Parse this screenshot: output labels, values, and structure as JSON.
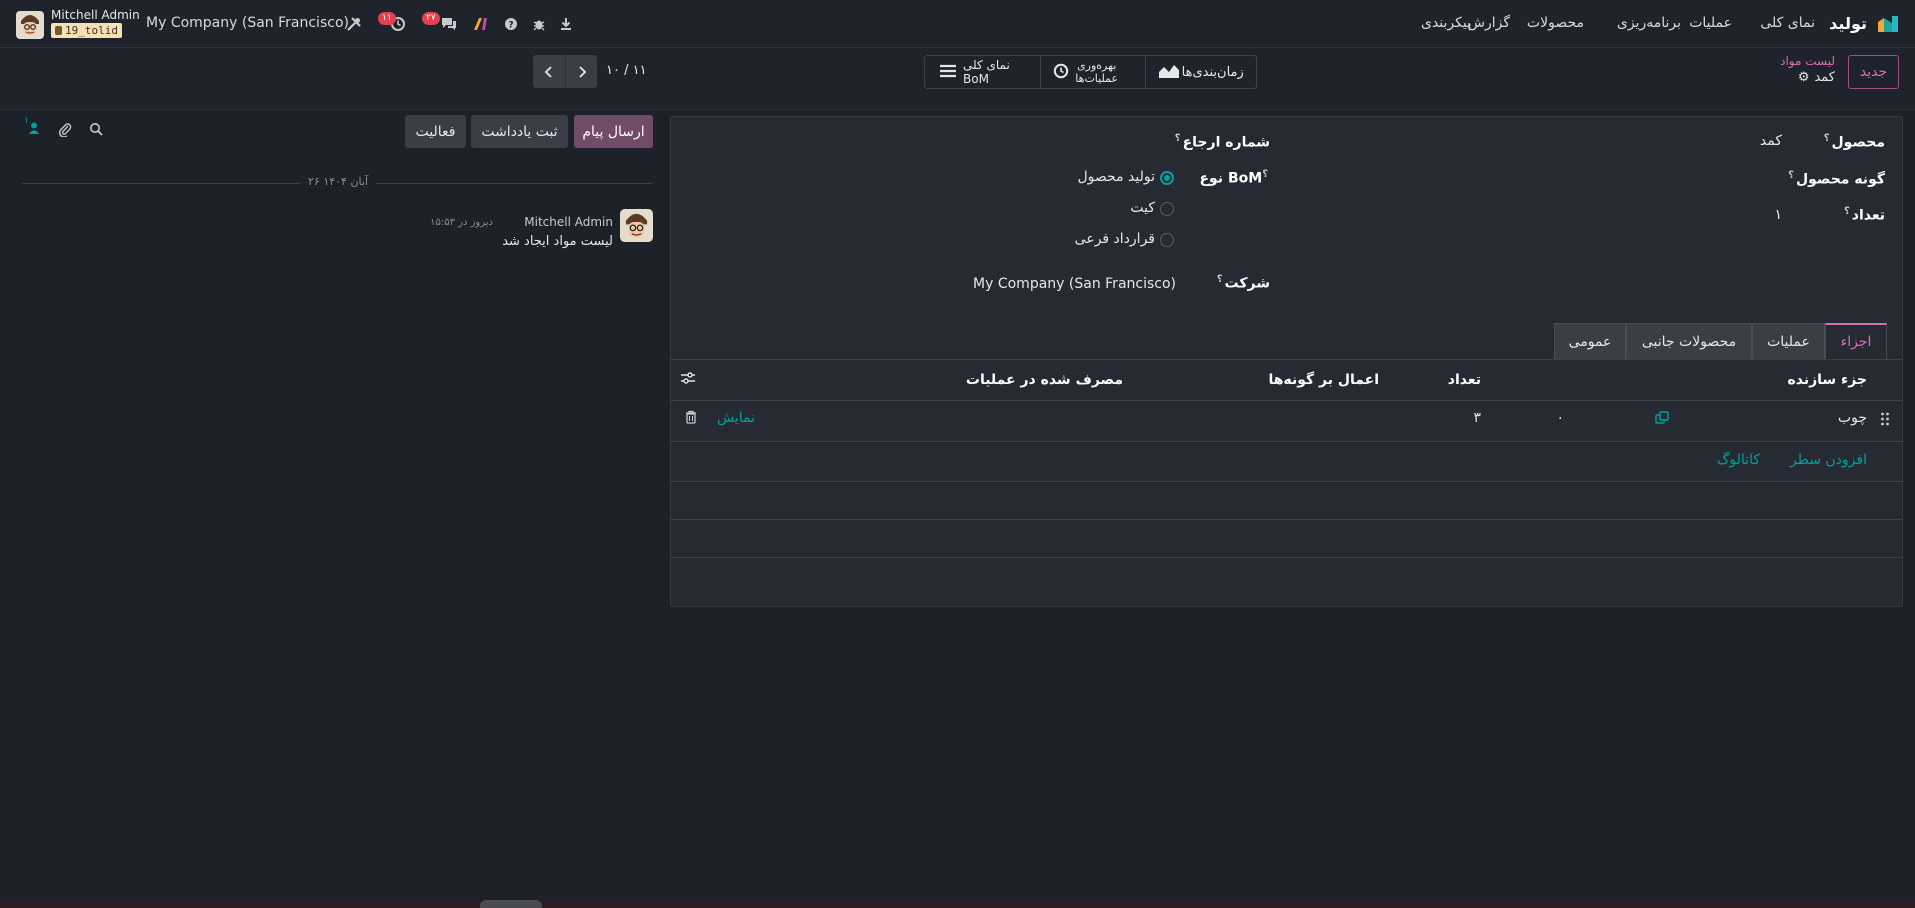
{
  "navbar": {
    "app_name": "تولید",
    "menu": [
      "نمای کلی",
      "عملیات",
      "برنامه‌ریزی",
      "محصولات",
      "گزارش",
      "پیکربندی"
    ],
    "company": "My Company (San Francisco)",
    "user_name": "Mitchell Admin",
    "db_name": "19_tolid",
    "activity_count": "۱۱",
    "message_count": "۲۷"
  },
  "control": {
    "new_button": "جدید",
    "breadcrumb_parent": "لیست مواد",
    "record_name": "کمد",
    "pager": "۱۰ / ۱۱",
    "smart_buttons": {
      "schedules": "زمان‌بندی‌ها",
      "efficiency_line1": "بهره‌وری",
      "efficiency_line2": "عملیات‌ها",
      "overview": "نمای کلی BoM"
    }
  },
  "form": {
    "product_label": "محصول",
    "product_value": "کمد",
    "variant_label": "گونه محصول",
    "quantity_label": "تعداد",
    "quantity_value": "۱",
    "reference_label": "شماره ارجاع",
    "bom_type_label": "نوع BoM",
    "bom_type_options": [
      "تولید محصول",
      "کیت",
      "قرارداد فرعی"
    ],
    "bom_type_selected": "تولید محصول",
    "company_label": "شرکت",
    "company_value": "My Company (San Francisco)",
    "help_mark": "؟"
  },
  "tabs": [
    "اجزاء",
    "عملیات",
    "محصولات جانبی",
    "عمومی"
  ],
  "tabs_active": "اجزاء",
  "table": {
    "headers": {
      "component": "جزء سازنده",
      "quantity": "تعداد",
      "apply_variants": "اعمال بر گونه‌ها",
      "consumed_in": "مصرف شده در عملیات"
    },
    "rows": [
      {
        "component": "چوب",
        "unit_qty": "۰",
        "quantity": "۳",
        "show": "نمایش"
      }
    ],
    "add_line": "افزودن سطر",
    "catalog": "کاتالوگ"
  },
  "chatter": {
    "send_message": "ارسال پیام",
    "log_note": "ثبت یادداشت",
    "activity": "فعالیت",
    "followers_count": "۱",
    "date_separator": "۲۶ آبان ۱۴۰۴",
    "messages": [
      {
        "author": "Mitchell Admin",
        "time": "دیروز در ۱۵:۵۳",
        "body": "لیست مواد ایجاد شد"
      }
    ]
  }
}
